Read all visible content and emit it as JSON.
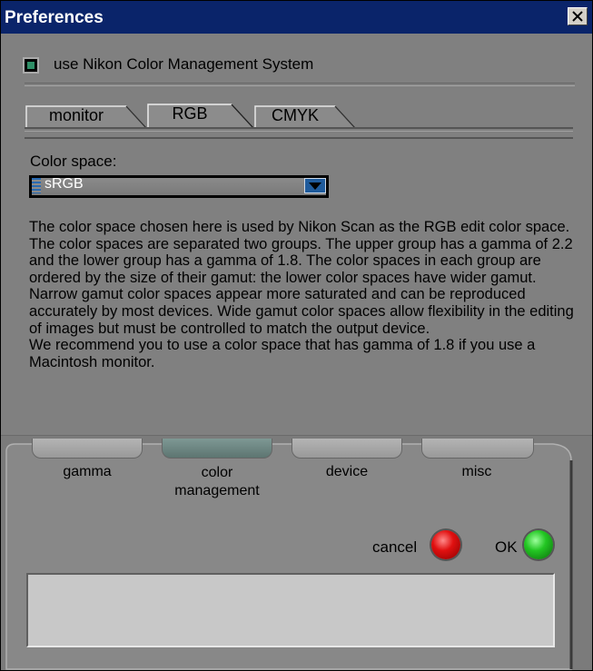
{
  "window": {
    "title": "Preferences"
  },
  "cms": {
    "checked": true,
    "label": "use Nikon Color Management System"
  },
  "tabs": [
    {
      "label": "monitor",
      "active": false
    },
    {
      "label": "RGB",
      "active": true
    },
    {
      "label": "CMYK",
      "active": false
    }
  ],
  "color_space": {
    "label": "Color space:",
    "value": "sRGB"
  },
  "description": [
    "The color space chosen here is used by Nikon Scan as the RGB edit color space. The color spaces are separated two groups. The upper group has a gamma of 2.2 and the lower group has a gamma of 1.8. The color spaces in each group are ordered by the size of their gamut: the lower color spaces have wider gamut.",
    "Narrow gamut color spaces appear more saturated and can be reproduced accurately by most devices. Wide gamut color spaces allow flexibility in the editing of images but must be controlled to match the output device.",
    "We recommend you to use a color space that has gamma of 1.8 if you use a Macintosh monitor."
  ],
  "categories": [
    {
      "label": "gamma",
      "active": false
    },
    {
      "label": "color management",
      "active": true
    },
    {
      "label": "device",
      "active": false
    },
    {
      "label": "misc",
      "active": false
    }
  ],
  "buttons": {
    "cancel": "cancel",
    "ok": "OK"
  },
  "colors": {
    "titlebar": "#0a246a",
    "panel": "#808080",
    "active_tab": "#6a8480",
    "cancel_orb": "#e01010",
    "ok_orb": "#23c623"
  },
  "icons": {
    "close": "close-icon",
    "dropdown": "chevron-down-icon"
  }
}
